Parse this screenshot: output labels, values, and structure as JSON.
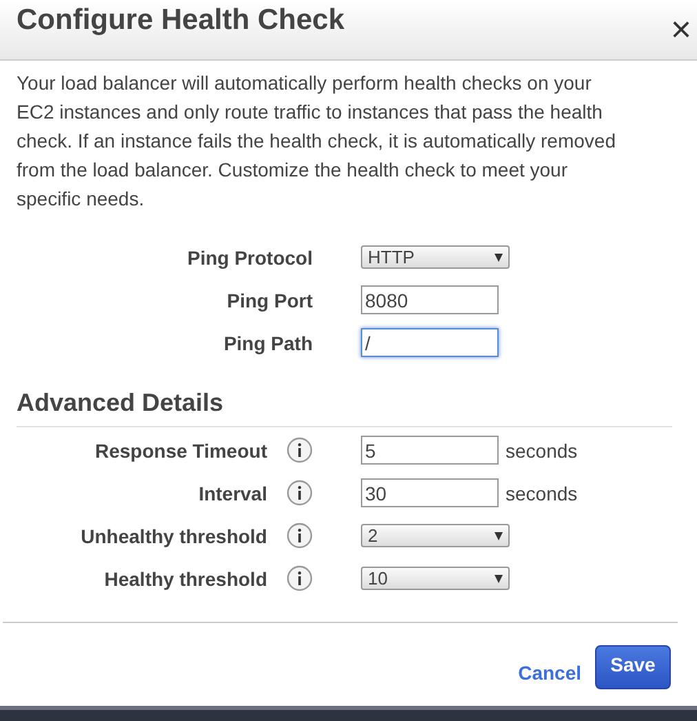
{
  "dialog": {
    "title": "Configure Health Check",
    "close": "×"
  },
  "description": "Your load balancer will automatically perform health checks on your EC2 instances and only route traffic to instances that pass the health check. If an instance fails the health check, it is automatically removed from the load balancer. Customize the health check to meet your specific needs.",
  "fields": [
    {
      "label": "Ping Protocol",
      "kind": "select",
      "value": "HTTP"
    },
    {
      "label": "Ping Port",
      "kind": "text",
      "value": "8080",
      "focused": false
    },
    {
      "label": "Ping Path",
      "kind": "text",
      "value": "/",
      "focused": true
    }
  ],
  "advanced": {
    "title": "Advanced Details",
    "fields": [
      {
        "label": "Response Timeout",
        "kind": "text",
        "value": "5",
        "unit": "seconds"
      },
      {
        "label": "Interval",
        "kind": "text",
        "value": "30",
        "unit": "seconds"
      },
      {
        "label": "Unhealthy threshold",
        "kind": "select",
        "value": "2"
      },
      {
        "label": "Healthy threshold",
        "kind": "select",
        "value": "10"
      }
    ]
  },
  "buttons": {
    "cancel": "Cancel",
    "save": "Save"
  }
}
